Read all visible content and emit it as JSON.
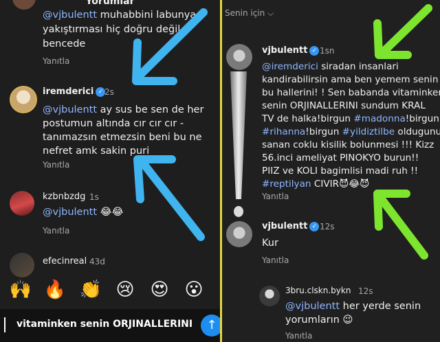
{
  "left": {
    "title": "Yorumlar",
    "top_comment": {
      "line1_prefix": "@vjbulentt",
      "line1_rest": " muhabbini labunya",
      "line2": "yakıştırması hiç doğru değil",
      "line3": "bencede",
      "reply": "Yanıtla"
    },
    "comments": [
      {
        "username": "iremderici",
        "time": "2s",
        "mention": "@vjbulentt",
        "text_after_mention": " ay sus be sen de her",
        "lines": [
          "postumun altında cır cır cır -",
          "tanımazsın etmezsin beni bu ne",
          "nefret amk sakin puri"
        ],
        "reply": "Yanıtla"
      },
      {
        "username": "kzbnbzdg",
        "time": "1s",
        "mention": "@vjbulentt",
        "text_after_mention": " 😂😂",
        "reply": "Yanıtla"
      },
      {
        "username": "efecinreal",
        "time": "43d"
      }
    ],
    "emoji_bar": [
      "🙌",
      "🔥",
      "👏",
      "😢",
      "😍",
      "😮"
    ],
    "composer_text": "vitaminken senin ORJINALLERINI",
    "send_icon": "↑"
  },
  "right": {
    "filter_label": "Senin için",
    "filter_chevron": "⌵",
    "comments": [
      {
        "username": "vjbulentt",
        "time": "1sn",
        "lines": [
          [
            {
              "t": "@iremderici",
              "c": "mention"
            },
            {
              "t": "  siradan insanlari",
              "c": ""
            }
          ],
          [
            {
              "t": "kandirabilirsin ama ben yemem senin",
              "c": ""
            }
          ],
          [
            {
              "t": "bu hallerini! ! Sen babanda vitaminken",
              "c": ""
            }
          ],
          [
            {
              "t": "senin ORJINALLERINI  sundum KRAL",
              "c": ""
            }
          ],
          [
            {
              "t": "TV de halka!birgun  ",
              "c": ""
            },
            {
              "t": "#madonna",
              "c": "tag"
            },
            {
              "t": "!birgun",
              "c": ""
            }
          ],
          [
            {
              "t": "#rihanna",
              "c": "tag"
            },
            {
              "t": "!birgun ",
              "c": ""
            },
            {
              "t": "#yildiztilbe",
              "c": "tag"
            },
            {
              "t": " oldugunu",
              "c": ""
            }
          ],
          [
            {
              "t": "sanan coklu kisilik bolunmesi !!! Kizz",
              "c": ""
            }
          ],
          [
            {
              "t": "56.inci  ameliyat  PINOKYO  burun!!",
              "c": ""
            }
          ],
          [
            {
              "t": "PIIZ ve KOLI  bagimlisi madi ruh !!",
              "c": ""
            }
          ],
          [
            {
              "t": "#reptilyan",
              "c": "tag"
            },
            {
              "t": " CIVIR😈😂😈",
              "c": ""
            }
          ]
        ],
        "reply": "Yanıtla"
      },
      {
        "username": "vjbulentt",
        "time": "12s",
        "text": "Kur",
        "reply": "Yanıtla"
      },
      {
        "username": "3bru.clskn.bykn",
        "time": "12s",
        "mention": "@vjbulentt",
        "text_after_mention": " her yerde senin",
        "line2": "yorumların 😉",
        "reply": "Yanıtla"
      }
    ]
  },
  "colors": {
    "accent_blue": "#3fb4ef",
    "accent_green": "#7ee52f",
    "mention": "#8fb6ff",
    "divider": "#e9d83a"
  }
}
